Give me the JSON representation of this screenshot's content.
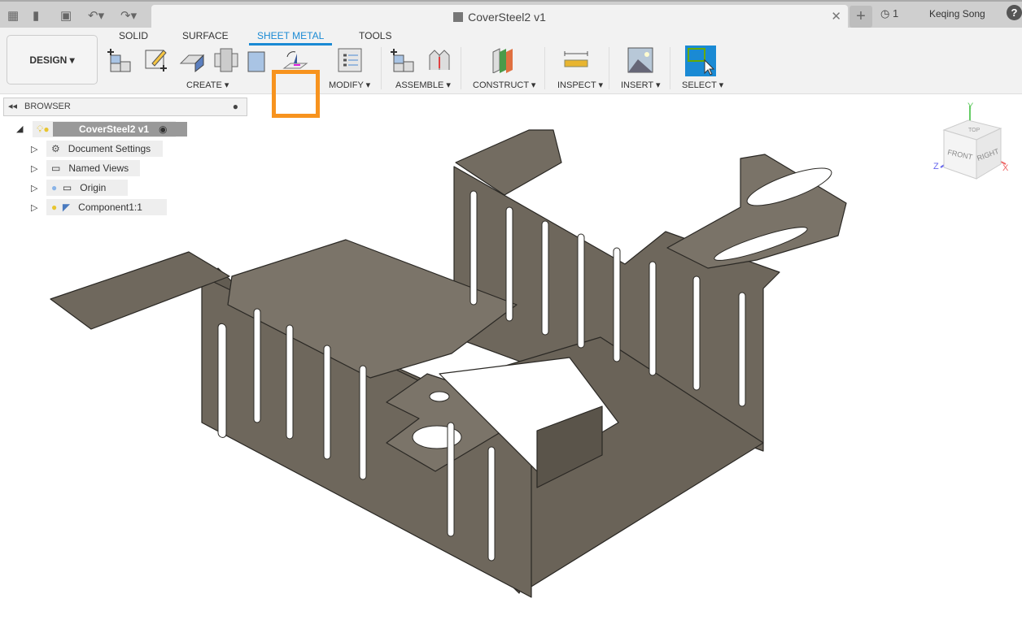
{
  "titlebar": {
    "document_title": "CoverSteel2 v1",
    "job_count": "1",
    "user": "Keqing Song",
    "help": "?"
  },
  "ribbon": {
    "workspace": "DESIGN",
    "tabs": [
      "SOLID",
      "SURFACE",
      "SHEET METAL",
      "TOOLS"
    ],
    "active_tab": "SHEET METAL",
    "groups": [
      "CREATE",
      "MODIFY",
      "ASSEMBLE",
      "CONSTRUCT",
      "INSPECT",
      "INSERT",
      "SELECT"
    ]
  },
  "browser": {
    "title": "BROWSER",
    "root": "CoverSteel2 v1",
    "items": [
      "Document Settings",
      "Named Views",
      "Origin",
      "Component1:1"
    ]
  },
  "viewcube": {
    "top": "TOP",
    "front": "FRONT",
    "right": "RIGHT",
    "x": "X",
    "y": "Y",
    "z": "Z"
  },
  "colors": {
    "accent": "#1a8ad4",
    "highlight": "#f7931e",
    "model": "#6e675c"
  }
}
